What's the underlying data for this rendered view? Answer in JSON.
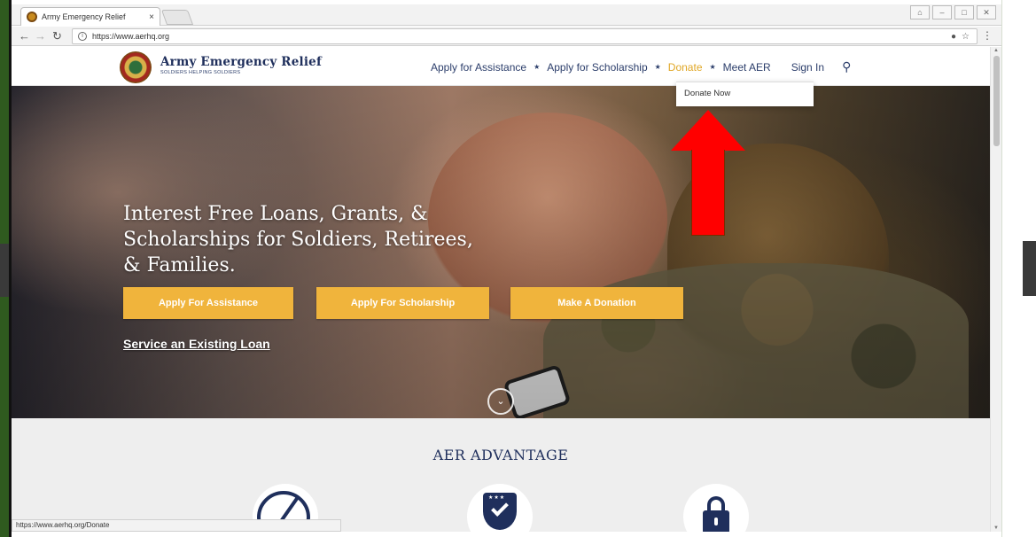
{
  "browser": {
    "tab_title": "Army Emergency Relief",
    "tab_close": "×",
    "url": "https://www.aerhq.org",
    "status_url": "https://www.aerhq.org/Donate"
  },
  "site": {
    "brand_name": "Army Emergency Relief",
    "brand_tagline": "SOLDIERS HELPING SOLDIERS",
    "nav": {
      "apply_assistance": "Apply for Assistance",
      "apply_scholarship": "Apply for Scholarship",
      "donate": "Donate",
      "meet_aer": "Meet AER",
      "sign_in": "Sign In",
      "separator": "★"
    },
    "dropdown": {
      "donate_now": "Donate Now"
    }
  },
  "hero": {
    "title": "Interest Free Loans, Grants, & Scholarships for Soldiers, Retirees, & Families.",
    "buttons": {
      "assistance": "Apply For Assistance",
      "scholarship": "Apply For Scholarship",
      "donation": "Make A Donation"
    },
    "service_link": "Service an Existing Loan"
  },
  "advantage": {
    "title": "AER ADVANTAGE"
  },
  "colors": {
    "accent": "#f0b43c",
    "brand_navy": "#1f2f5c",
    "annotation_arrow": "#ff0000"
  }
}
